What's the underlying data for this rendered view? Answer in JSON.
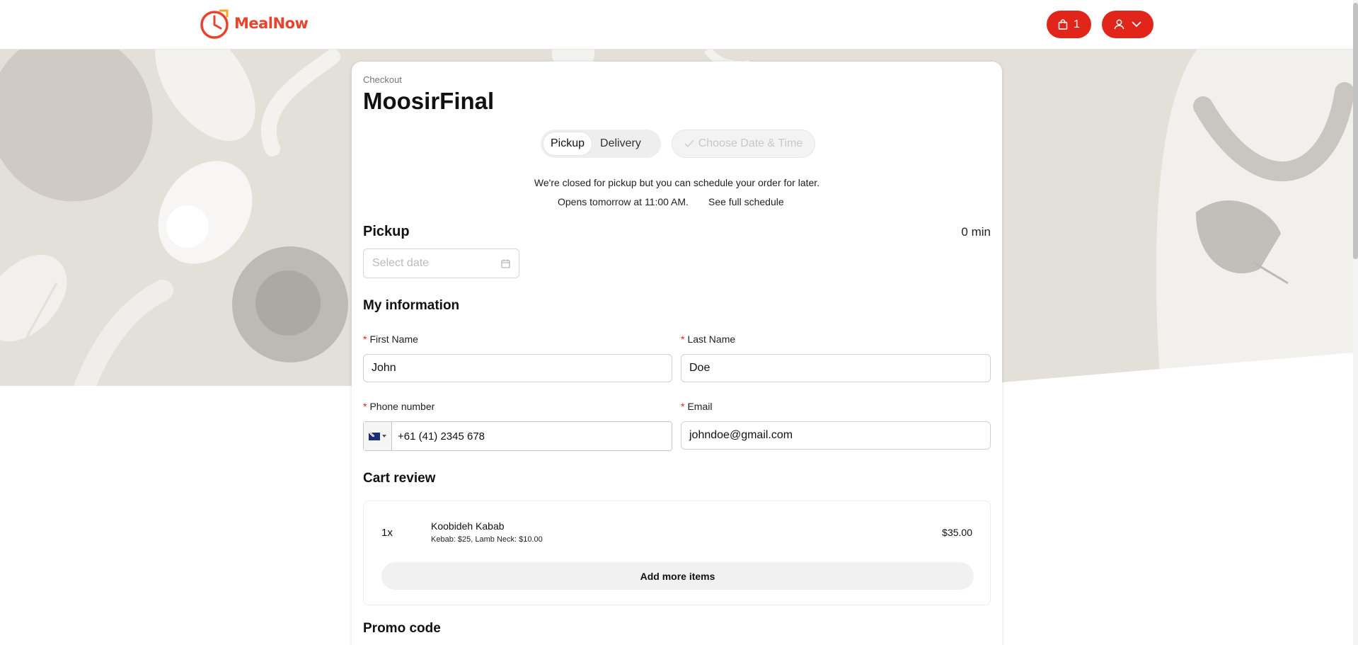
{
  "header": {
    "brand": "MealNow",
    "cart_count": "1",
    "colors": {
      "brand": "#e8432d",
      "accent": "#e1251b"
    },
    "icons": {
      "logo": "clock-logo-icon",
      "cart": "shopping-bag-icon",
      "user": "user-icon",
      "dropdown": "chevron-down-icon"
    }
  },
  "checkout": {
    "breadcrumb": "Checkout",
    "store_name": "MoosirFinal",
    "modes": [
      "Pickup",
      "Delivery"
    ],
    "active_mode": "Pickup",
    "date_time_button": "Choose Date & Time",
    "closed_message": "We're closed for pickup but you can schedule your order for later.",
    "opens_message": "Opens tomorrow at 11:00 AM.",
    "schedule_link": "See full schedule"
  },
  "pickup": {
    "title": "Pickup",
    "time": "0 min",
    "date_placeholder": "Select date"
  },
  "info": {
    "title": "My information",
    "first_name": {
      "label": "First Name",
      "value": "John"
    },
    "last_name": {
      "label": "Last Name",
      "value": "Doe"
    },
    "phone": {
      "label": "Phone number",
      "value": "+61 (41) 2345 678",
      "country": "AU"
    },
    "email": {
      "label": "Email",
      "value": "johndoe@gmail.com"
    },
    "required_mark": "*"
  },
  "cart": {
    "title": "Cart review",
    "items": [
      {
        "qty": "1x",
        "name": "Koobideh Kabab",
        "modifiers": "Kebab: $25, Lamb Neck: $10.00",
        "price": "$35.00"
      }
    ],
    "add_more": "Add more items"
  },
  "promo": {
    "title": "Promo code"
  }
}
